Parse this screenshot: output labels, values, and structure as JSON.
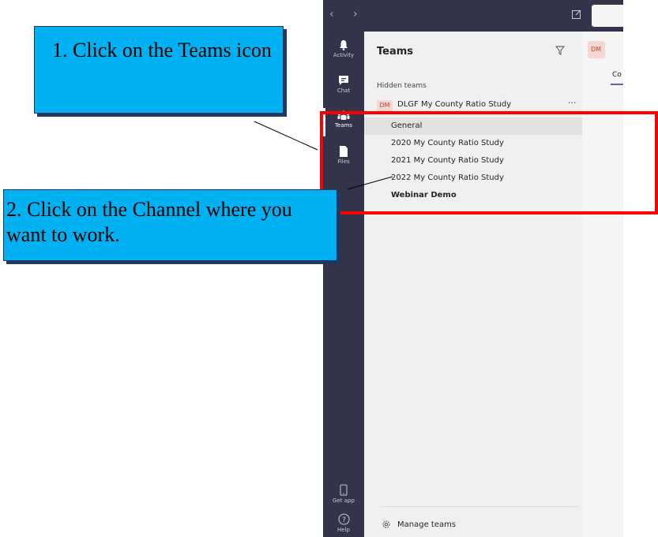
{
  "rail": {
    "items": [
      {
        "label": "Activity",
        "icon": "bell-icon"
      },
      {
        "label": "Chat",
        "icon": "chat-icon"
      },
      {
        "label": "Teams",
        "icon": "teams-icon",
        "active": true
      },
      {
        "label": "Files",
        "icon": "file-icon"
      }
    ],
    "bottom": [
      {
        "label": "Get app",
        "icon": "phone-icon"
      },
      {
        "label": "Help",
        "icon": "help-icon"
      }
    ]
  },
  "panel": {
    "title": "Teams",
    "hidden_label": "Hidden teams",
    "team": {
      "initials": "DM",
      "name": "DLGF My County Ratio Study",
      "more": "···"
    },
    "channels": [
      {
        "name": "General",
        "selected": true
      },
      {
        "name": "2020 My County Ratio Study"
      },
      {
        "name": "2021 My County Ratio Study"
      },
      {
        "name": "2022 My County Ratio Study"
      },
      {
        "name": "Webinar Demo",
        "bold": true
      }
    ],
    "manage": "Manage teams"
  },
  "content": {
    "avatar": "DM",
    "tab": "Co"
  },
  "callouts": {
    "step1": "1. Click on the Teams icon",
    "step2": "2. Click on the Channel where you want to work."
  },
  "colors": {
    "rail": "#33344a",
    "accent": "#6264a7",
    "callout": "#00b0f0",
    "highlight": "#ff0000"
  }
}
